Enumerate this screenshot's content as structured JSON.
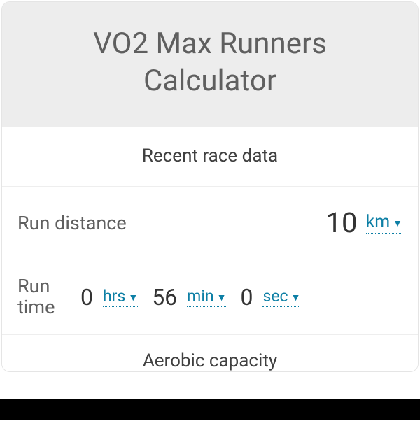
{
  "header": {
    "title": "VO2 Max Runners Calculator"
  },
  "section1": {
    "title": "Recent race data"
  },
  "distance": {
    "label": "Run distance",
    "value": "10",
    "unit": "km"
  },
  "time": {
    "label": "Run time",
    "parts": [
      {
        "value": "0",
        "unit": "hrs"
      },
      {
        "value": "56",
        "unit": "min"
      },
      {
        "value": "0",
        "unit": "sec"
      }
    ]
  },
  "section2": {
    "title": "Aerobic capacity"
  }
}
